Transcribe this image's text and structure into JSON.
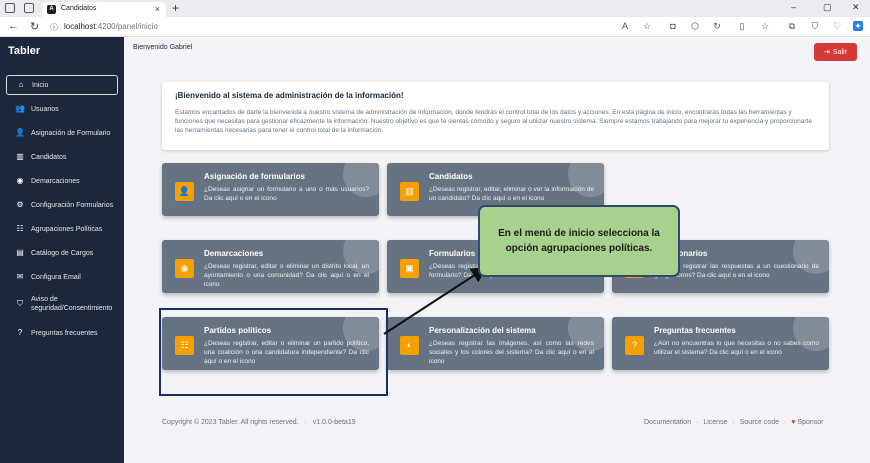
{
  "browser": {
    "tab_title": "Candidatos",
    "tab_favicon": "A",
    "url_host": "localhost",
    "url_path": ":4200/panel/inicio"
  },
  "sidebar": {
    "brand": "Tabler",
    "items": [
      {
        "label": "Inicio",
        "icon": "home-icon",
        "glyph": "⌂"
      },
      {
        "label": "Usuarios",
        "icon": "users-icon",
        "glyph": "👥"
      },
      {
        "label": "Asignación de Formulario",
        "icon": "user-assign-icon",
        "glyph": "👤"
      },
      {
        "label": "Candidatos",
        "icon": "podium-icon",
        "glyph": "▥"
      },
      {
        "label": "Demarcaciones",
        "icon": "map-pin-icon",
        "glyph": "◉"
      },
      {
        "label": "Configuración Formularios",
        "icon": "settings-icon",
        "glyph": "⚙"
      },
      {
        "label": "Agrupaciones Políticas",
        "icon": "group-icon",
        "glyph": "☷"
      },
      {
        "label": "Catálogo de Cargos",
        "icon": "briefcase-icon",
        "glyph": "▤"
      },
      {
        "label": "Configura Email",
        "icon": "mail-icon",
        "glyph": "✉"
      },
      {
        "label": "Aviso de seguridad/Consentimiento",
        "icon": "shield-icon",
        "glyph": "⛉"
      },
      {
        "label": "Preguntas frecuentes",
        "icon": "help-icon",
        "glyph": "?"
      }
    ]
  },
  "header": {
    "welcome": "Bienvenido Gabriel",
    "logout_label": "Salir"
  },
  "welcome_card": {
    "title": "¡Bienvenido al sistema de administración de la información!",
    "body": "Estamos encantados de darte la bienvenida a nuestro sistema de administración de información, donde tendrás el control total de los datos y acciones. En esta página de inicio, encontrarás todas las herramientas y funciones que necesitas para gestionar eficazmente la información. Nuestro objetivo es que te sientas cómodo y seguro al utilizar nuestro sistema. Siempre estamos trabajando para mejorar tu experiencia y proporcionarte las herramientas necesarias para tener el control total de la información."
  },
  "cards": [
    {
      "title": "Asignación de formularios",
      "desc": "¿Deseas asignar un formulario a uno o más usuarios? Da clic aquí o en el icono",
      "icon": "user-assign-icon",
      "glyph": "👤"
    },
    {
      "title": "Candidatos",
      "desc": "¿Deseas registrar, editar, eliminar o ver la información de un candidato? Da clic aquí o en el icono",
      "icon": "podium-icon",
      "glyph": "▥"
    },
    {
      "title": "Demarcaciones",
      "desc": "¿Deseas registrar, editar o eliminar un distrito local, un ayuntamiento o una comunidad? Da clic aquí o en el icono",
      "icon": "map-pin-icon",
      "glyph": "◉"
    },
    {
      "title": "Formularios",
      "desc": "¿Deseas registrar, editar o eliminar los campos de un formulario? Da clic aquí o en el icono",
      "icon": "form-icon",
      "glyph": "▣"
    },
    {
      "title": "Cuestionarios",
      "desc": "¿Deseas registrar las respuestas a un cuestionario de google forms? Da clic aquí o en el icono",
      "icon": "list-icon",
      "glyph": "≡"
    },
    {
      "title": "Partidos políticos",
      "desc": "¿Deseas registrar, editar o eliminar un partido político, una coalición o una candidatura independiente? Da clic aquí o en el icono",
      "icon": "group-icon",
      "glyph": "☷"
    },
    {
      "title": "Personalización del sistema",
      "desc": "¿Deseas registrar las imágenes, así como las redes sociales y los colores del sistema? Da clic aquí o en el icono",
      "icon": "palette-icon",
      "glyph": "◐"
    },
    {
      "title": "Preguntas frecuentes",
      "desc": "¿Aún no encuentras lo que necesitas o no sabes como utilizar el sistema? Da clic aquí o en el icono",
      "icon": "help-icon",
      "glyph": "?"
    }
  ],
  "callout": {
    "text": "En el menú de inicio selecciona la opción agrupaciones políticas."
  },
  "footer": {
    "copyright": "Copyright © 2023 Tabler. All rights reserved.",
    "version": "v1.0.0-beta19",
    "links": [
      "Documentation",
      "License",
      "Source code",
      "Sponsor"
    ]
  },
  "colors": {
    "sidebar": "#1d273b",
    "card": "#667382",
    "badge": "#f59f00",
    "logout": "#d63939",
    "callout": "#a9d18e"
  }
}
